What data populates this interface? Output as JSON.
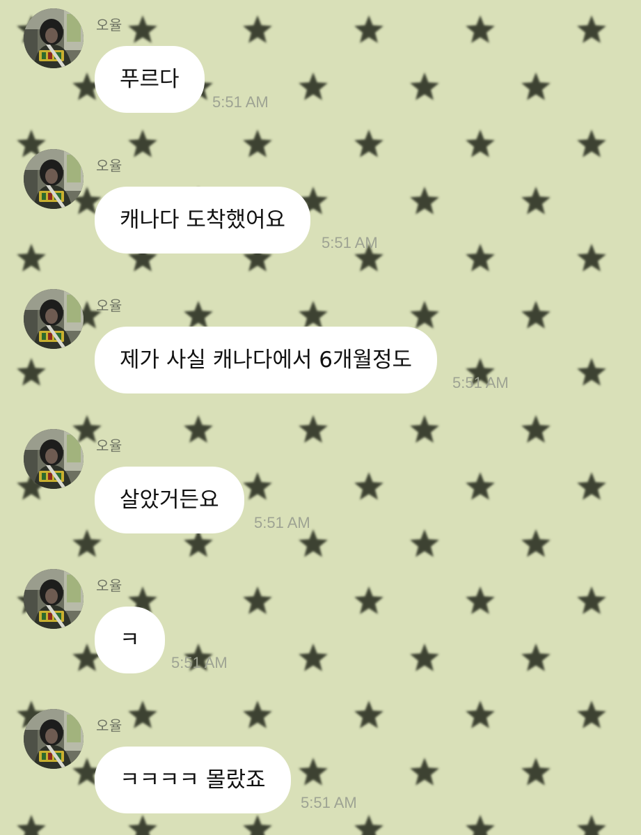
{
  "theme": {
    "background": "#d9e0b8",
    "pattern_star_color": "#3c4233",
    "bubble_color": "#ffffff",
    "sender_color": "#6f7464",
    "timestamp_color": "#9ea393",
    "background_pattern": "star-icon"
  },
  "messages": [
    {
      "sender": "오율",
      "text": "푸르다",
      "time": "5:51 AM"
    },
    {
      "sender": "오율",
      "text": "캐나다 도착했어요",
      "time": "5:51 AM"
    },
    {
      "sender": "오율",
      "text": "제가 사실 캐나다에서 6개월정도",
      "time": "5:51 AM"
    },
    {
      "sender": "오율",
      "text": "살았거든요",
      "time": "5:51 AM"
    },
    {
      "sender": "오율",
      "text": "ㅋ",
      "time": "5:51 AM"
    },
    {
      "sender": "오율",
      "text": "ㅋㅋㅋㅋ 몰랐죠",
      "time": "5:51 AM"
    }
  ]
}
